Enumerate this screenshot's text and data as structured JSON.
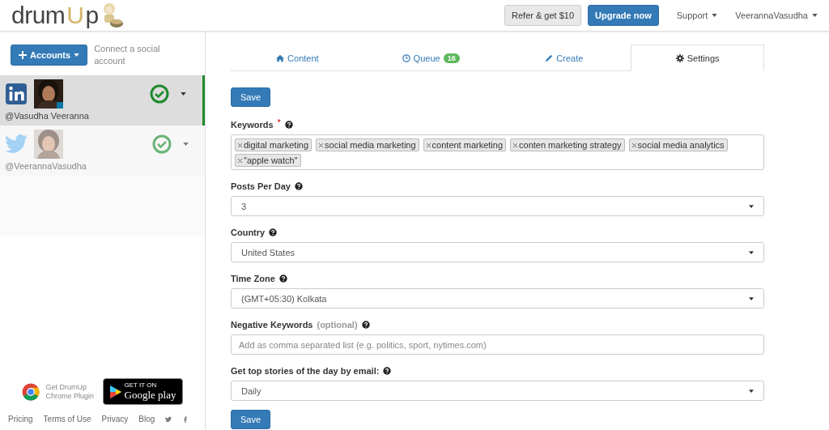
{
  "header": {
    "logo": [
      "drum",
      "U",
      "p"
    ],
    "refer_button": "Refer & get $10",
    "upgrade_button": "Upgrade now",
    "menus": [
      {
        "label": "Support"
      },
      {
        "label": "VeerannaVasudha"
      }
    ]
  },
  "sidebar": {
    "accounts_button": "Accounts",
    "connect_text": "Connect a social account",
    "accounts": [
      {
        "handle": "@Vasudha Veeranna",
        "selected": true
      },
      {
        "handle": "@VeerannaVasudha",
        "selected": false
      }
    ],
    "plugin_text": "Get DrumUp Chrome Plugin",
    "play_badge": {
      "top": "GET IT ON",
      "bottom": "Google play"
    },
    "footer_links": [
      "Pricing",
      "Terms of Use",
      "Privacy",
      "Blog"
    ]
  },
  "tabs": [
    {
      "label": "Content",
      "selected": false
    },
    {
      "label": "Queue",
      "badge": "16",
      "selected": false
    },
    {
      "label": "Create",
      "selected": false
    },
    {
      "label": "Settings",
      "selected": true
    }
  ],
  "save_button": "Save",
  "fields": [
    {
      "kind": "tags",
      "label": "Keywords",
      "required_mark": "*",
      "tags": [
        "digital marketing",
        "social media marketing",
        "content marketing",
        "conten marketing strategy",
        "social media analytics",
        "\"apple watch\""
      ]
    },
    {
      "kind": "select",
      "label": "Posts Per Day",
      "value": "3"
    },
    {
      "kind": "select",
      "label": "Country",
      "value": "United States"
    },
    {
      "kind": "select",
      "label": "Time Zone",
      "value": "(GMT+05:30) Kolkata"
    },
    {
      "kind": "input",
      "label": "Negative Keywords",
      "hint": "(optional)",
      "placeholder": "Add as comma separated list (e.g. politics, sport, nytimes.com)"
    },
    {
      "kind": "select",
      "label": "Get top stories of the day by email:",
      "value": "Daily"
    }
  ],
  "bottom_save_button": "Save"
}
